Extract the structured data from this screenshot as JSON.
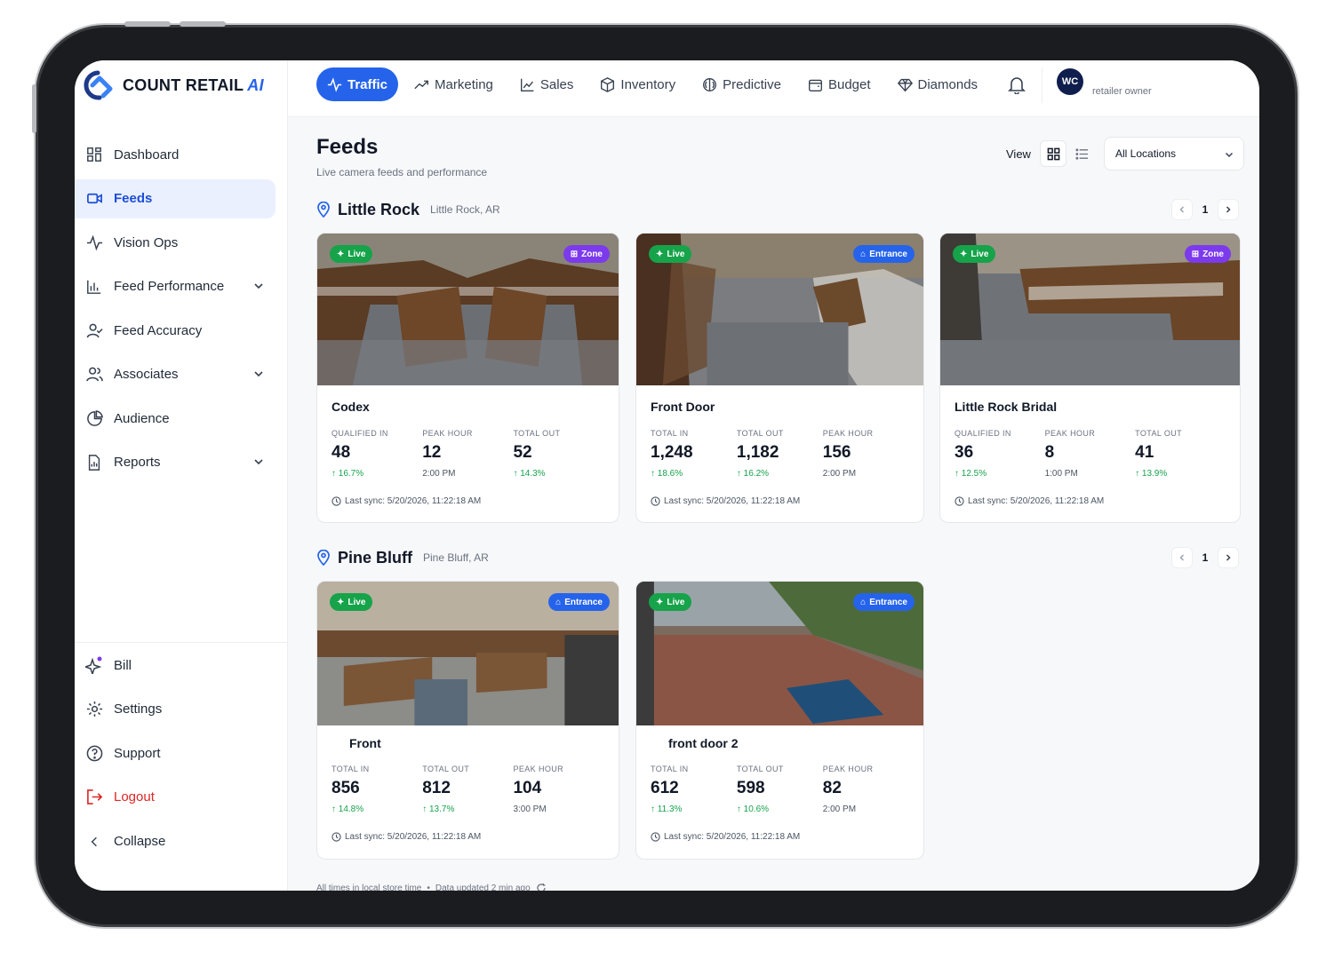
{
  "brand": {
    "name": "COUNT RETAIL",
    "suffix": "AI",
    "accent": "#2563eb"
  },
  "topnav": {
    "tabs": [
      {
        "label": "Traffic",
        "icon": "activity-icon",
        "active": true
      },
      {
        "label": "Marketing",
        "icon": "trend-icon"
      },
      {
        "label": "Sales",
        "icon": "chart-line-icon"
      },
      {
        "label": "Inventory",
        "icon": "package-icon"
      },
      {
        "label": "Predictive",
        "icon": "brain-icon"
      },
      {
        "label": "Budget",
        "icon": "wallet-icon"
      },
      {
        "label": "Diamonds",
        "icon": "diamond-icon"
      }
    ],
    "user_initials": "WC",
    "user_role": "retailer owner"
  },
  "sidebar": {
    "items": [
      {
        "label": "Dashboard"
      },
      {
        "label": "Feeds"
      },
      {
        "label": "Vision Ops"
      },
      {
        "label": "Feed Performance"
      },
      {
        "label": "Feed Accuracy"
      },
      {
        "label": "Associates"
      },
      {
        "label": "Audience"
      },
      {
        "label": "Reports"
      }
    ],
    "bottom": [
      {
        "label": "Bill"
      },
      {
        "label": "Settings"
      },
      {
        "label": "Support"
      },
      {
        "label": "Logout"
      }
    ],
    "collapse_label": "Collapse"
  },
  "page": {
    "title": "Feeds",
    "subtitle": "Live camera feeds and performance",
    "view_label": "View",
    "location_filter": "All Locations"
  },
  "locations": [
    {
      "name": "Little Rock",
      "sub": "Little Rock, AR",
      "page": "1",
      "cards": [
        {
          "title": "Codex",
          "live": "Live",
          "tag": "Zone",
          "stats": [
            {
              "label": "QUALIFIED IN",
              "value": "48",
              "delta": "↑ 16.7%"
            },
            {
              "label": "PEAK HOUR",
              "value": "12",
              "delta": "2:00 PM"
            },
            {
              "label": "TOTAL OUT",
              "value": "52",
              "delta": "↑ 14.3%"
            }
          ],
          "sync": "Last sync: 5/20/2026, 11:22:18 AM"
        },
        {
          "title": "Front Door",
          "live": "Live",
          "tag": "Entrance",
          "stats": [
            {
              "label": "TOTAL IN",
              "value": "1,248",
              "delta": "↑ 18.6%"
            },
            {
              "label": "TOTAL OUT",
              "value": "1,182",
              "delta": "↑ 16.2%"
            },
            {
              "label": "PEAK HOUR",
              "value": "156",
              "delta": "2:00 PM"
            }
          ],
          "sync": "Last sync: 5/20/2026, 11:22:18 AM"
        },
        {
          "title": "Little Rock Bridal",
          "live": "Live",
          "tag": "Zone",
          "stats": [
            {
              "label": "QUALIFIED IN",
              "value": "36",
              "delta": "↑ 12.5%"
            },
            {
              "label": "PEAK HOUR",
              "value": "8",
              "delta": "1:00 PM"
            },
            {
              "label": "TOTAL OUT",
              "value": "41",
              "delta": "↑ 13.9%"
            }
          ],
          "sync": "Last sync: 5/20/2026, 11:22:18 AM"
        }
      ]
    },
    {
      "name": "Pine Bluff",
      "sub": "Pine Bluff, AR",
      "page": "1",
      "cards": [
        {
          "title": "Front",
          "live": "Live",
          "tag": "Entrance",
          "stats": [
            {
              "label": "TOTAL IN",
              "value": "856",
              "delta": "↑ 14.8%"
            },
            {
              "label": "TOTAL OUT",
              "value": "812",
              "delta": "↑ 13.7%"
            },
            {
              "label": "PEAK HOUR",
              "value": "104",
              "delta": "3:00 PM"
            }
          ],
          "sync": "Last sync: 5/20/2026, 11:22:18 AM"
        },
        {
          "title": "front door 2",
          "live": "Live",
          "tag": "Entrance",
          "stats": [
            {
              "label": "TOTAL IN",
              "value": "612",
              "delta": "↑ 11.3%"
            },
            {
              "label": "TOTAL OUT",
              "value": "598",
              "delta": "↑ 10.6%"
            },
            {
              "label": "PEAK HOUR",
              "value": "82",
              "delta": "2:00 PM"
            }
          ],
          "sync": "Last sync: 5/20/2026, 11:22:18 AM"
        }
      ]
    }
  ],
  "footer": {
    "note": "All times in local store time",
    "updated": "Data updated 2 min ago"
  },
  "colors": {
    "live": "#16a34a",
    "zone": "#7c3aed",
    "entrance": "#2563eb",
    "positive": "#16a34a",
    "logout": "#dc2626"
  }
}
